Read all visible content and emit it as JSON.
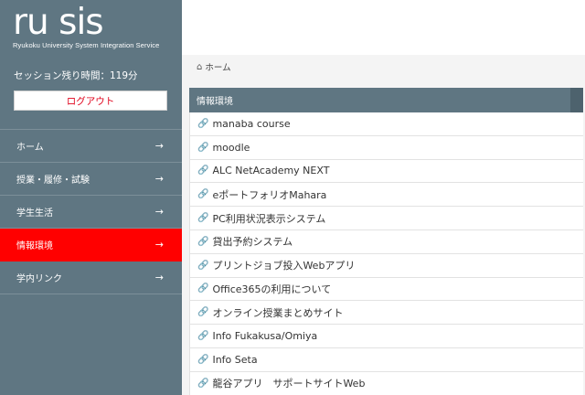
{
  "brand": {
    "logo": "ru sis",
    "subtitle": "Ryukoku University System Integration Service"
  },
  "session": {
    "text": "セッション残り時間：119分"
  },
  "logout_label": "ログアウト",
  "nav": {
    "items": [
      {
        "label": "ホーム",
        "arrow": "→",
        "active": false
      },
      {
        "label": "授業・履修・試験",
        "arrow": "→",
        "active": false
      },
      {
        "label": "学生生活",
        "arrow": "→",
        "active": false
      },
      {
        "label": "情報環境",
        "arrow": "→",
        "active": true
      },
      {
        "label": "学内リンク",
        "arrow": "→",
        "active": false
      }
    ]
  },
  "breadcrumb": {
    "icon": "home-icon",
    "label": "ホーム"
  },
  "panel": {
    "title": "情報環境",
    "links": [
      {
        "label": "manaba course"
      },
      {
        "label": "moodle"
      },
      {
        "label": "ALC NetAcademy NEXT"
      },
      {
        "label": "eポートフォリオMahara"
      },
      {
        "label": "PC利用状況表示システム"
      },
      {
        "label": "貸出予約システム"
      },
      {
        "label": "プリントジョブ投入Webアプリ"
      },
      {
        "label": "Office365の利用について"
      },
      {
        "label": "オンライン授業まとめサイト"
      },
      {
        "label": "Info Fukakusa/Omiya"
      },
      {
        "label": "Info Seta"
      },
      {
        "label": "龍谷アプリ　サポートサイトWeb"
      }
    ]
  },
  "colors": {
    "sidebar": "#5f7682",
    "active": "#ff0000",
    "logout_text": "#e0001a"
  }
}
